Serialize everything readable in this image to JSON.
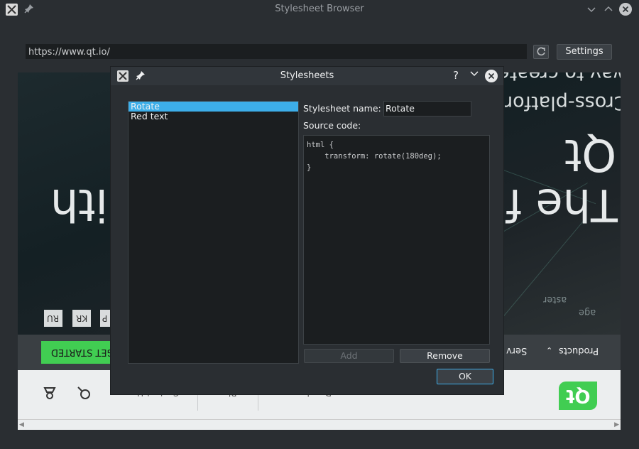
{
  "window": {
    "title": "Stylesheet Browser"
  },
  "toolbar": {
    "url": "https://www.qt.io/",
    "settings_label": "Settings"
  },
  "webpage": {
    "hero_line1": "The f",
    "hero_line1b": "ith",
    "hero_qt": "Qt",
    "hero_sub1": "Cross-platfor",
    "hero_sub2": "way to create",
    "side1": "age",
    "side2": "aster",
    "langs": [
      "RU",
      "KR",
      "P"
    ],
    "get_started": "GET STARTED",
    "nav_products": "Products",
    "nav_services": "Serv",
    "footer_links": [
      "Developers",
      "Blog",
      "Contact Us"
    ],
    "logo_text": "Qt"
  },
  "dialog": {
    "title": "Stylesheets",
    "help": "?",
    "list_items": [
      "Rotate",
      "Red text"
    ],
    "selected_index": 0,
    "name_label": "Stylesheet name:",
    "name_value": "Rotate",
    "source_label": "Source code:",
    "source_code": "html {\n    transform: rotate(180deg);\n}",
    "add_label": "Add",
    "remove_label": "Remove",
    "ok_label": "OK"
  },
  "colors": {
    "accent": "#3daee9",
    "qt_green": "#41cd52",
    "background": "#2a2e32"
  }
}
